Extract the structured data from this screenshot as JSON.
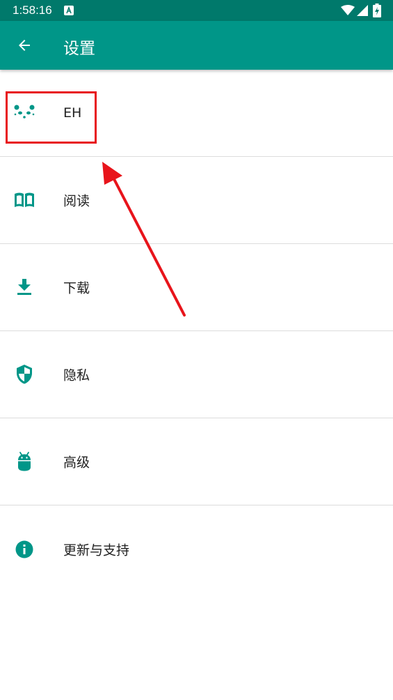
{
  "status_bar": {
    "time": "1:58:16",
    "notification_icon": "a-icon",
    "wifi_icon": "wifi-icon",
    "signal_icon": "signal-icon",
    "battery_icon": "battery-charging-icon"
  },
  "app_bar": {
    "back_icon": "arrow-left-icon",
    "title": "设置"
  },
  "settings": {
    "items": [
      {
        "label": "EH",
        "icon": "panda-icon"
      },
      {
        "label": "阅读",
        "icon": "book-icon"
      },
      {
        "label": "下载",
        "icon": "download-icon"
      },
      {
        "label": "隐私",
        "icon": "shield-icon"
      },
      {
        "label": "高级",
        "icon": "android-icon"
      },
      {
        "label": "更新与支持",
        "icon": "info-icon"
      }
    ]
  },
  "colors": {
    "status_bar": "#00796b",
    "app_bar": "#009688",
    "icon": "#009688",
    "annotation": "#e8141b"
  }
}
